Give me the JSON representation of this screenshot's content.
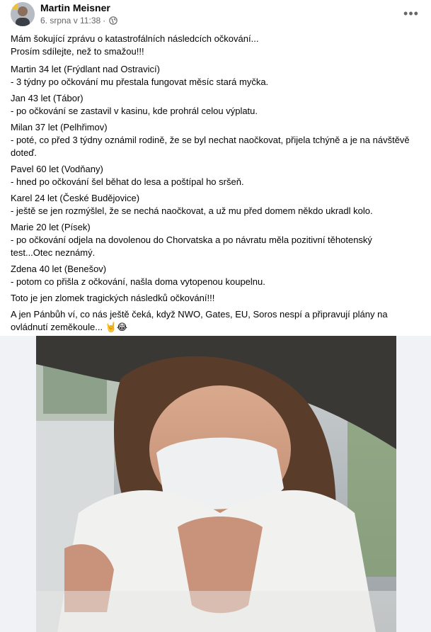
{
  "post": {
    "author": "Martin Meisner",
    "date": "6. srpna v 11:38",
    "privacy_icon": "globe-icon",
    "more_icon": "more-options-icon",
    "paragraphs": [
      {
        "lines": [
          "Mám šokující zprávu o katastrofálních následcích očkování...",
          "Prosím sdílejte, než to smažou!!!"
        ]
      },
      {
        "lines": [
          "Martin 34 let (Frýdlant nad Ostravicí)",
          "- 3 týdny po očkování mu přestala fungovat měsíc stará myčka."
        ]
      },
      {
        "lines": [
          "Jan 43 let (Tábor)",
          " - po očkování se zastavil v kasinu, kde prohrál celou výplatu."
        ]
      },
      {
        "lines": [
          "Milan 37 let (Pelhřimov)",
          "- poté, co před 3 týdny oznámil rodině, že se byl nechat naočkovat, přijela tchýně a je na návštěvě",
          "doteď."
        ]
      },
      {
        "lines": [
          "Pavel 60 let (Vodňany)",
          "- hned po očkování šel běhat do lesa a poštípal ho sršeň."
        ]
      },
      {
        "lines": [
          "Karel 24 let (České Budějovice)",
          "- ještě se jen rozmýšlel, že se nechá naočkovat, a už mu před domem někdo ukradl kolo."
        ]
      },
      {
        "lines": [
          "Marie 20 let (Písek)",
          "- po očkování odjela na dovolenou do Chorvatska a po návratu měla pozitivní těhotenský",
          "test...Otec neznámý."
        ]
      },
      {
        "lines": [
          "Zdena 40 let (Benešov)",
          "- potom co přišla z očkování, našla doma vytopenou koupelnu."
        ]
      },
      {
        "lines": [
          "Toto je jen zlomek tragických následků očkování!!!"
        ]
      },
      {
        "lines": [
          "A jen Pánbůh ví, co nás ještě čeká, když NWO, Gates, EU, Soros nespí a připravují plány na",
          "ovládnutí zeměkoule... 🤘😂"
        ]
      }
    ]
  },
  "colors": {
    "text": "#050505",
    "secondary": "#65676b",
    "photo_frame": "#f0f2f5"
  }
}
